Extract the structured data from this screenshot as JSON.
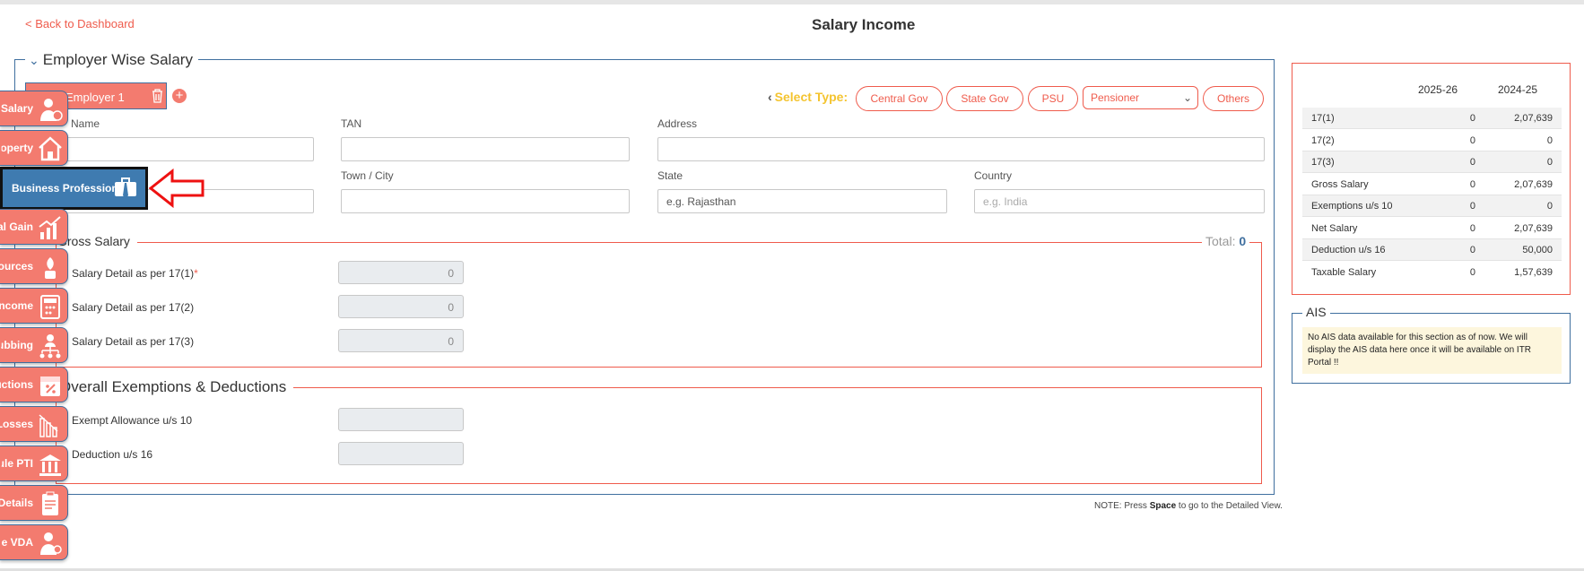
{
  "header": {
    "back_link": "< Back to Dashboard",
    "title": "Salary Income"
  },
  "employer": {
    "section_title": "Employer Wise Salary",
    "tab_label": "Employer 1",
    "select_type_label": "Select Type:",
    "types": [
      "Central Gov",
      "State Gov",
      "PSU"
    ],
    "pensioner_value": "Pensioner",
    "others_label": "Others",
    "fields": {
      "name_label": "Name",
      "tan_label": "TAN",
      "address_label": "Address",
      "town_label": "Town / City",
      "state_label": "State",
      "state_placeholder": "e.g. Rajasthan",
      "country_label": "Country",
      "country_placeholder": "e.g. India"
    }
  },
  "gross": {
    "title": "Gross Salary",
    "total_label": "Total:",
    "total_value": "0",
    "rows": [
      {
        "label": "Salary Detail as per 17(1)",
        "required": "*",
        "value": "0"
      },
      {
        "label": "Salary Detail as per 17(2)",
        "value": "0"
      },
      {
        "label": "Salary Detail as per 17(3)",
        "value": "0"
      }
    ]
  },
  "exemptions": {
    "title": "Overall Exemptions & Deductions",
    "rows": [
      {
        "label": "Exempt Allowance u/s 10",
        "value": ""
      },
      {
        "label": "Deduction u/s 16",
        "value": ""
      }
    ]
  },
  "note": {
    "prefix": "NOTE: Press ",
    "key": "Space",
    "suffix": " to go to the Detailed View."
  },
  "summary": {
    "col1": "2025-26",
    "col2": "2024-25",
    "rows": [
      {
        "key": "17(1)",
        "v1": "0",
        "v2": "2,07,639"
      },
      {
        "key": "17(2)",
        "v1": "0",
        "v2": "0"
      },
      {
        "key": "17(3)",
        "v1": "0",
        "v2": "0"
      },
      {
        "key": "Gross Salary",
        "v1": "0",
        "v2": "2,07,639"
      },
      {
        "key": "Exemptions u/s 10",
        "v1": "0",
        "v2": "0"
      },
      {
        "key": "Net Salary",
        "v1": "0",
        "v2": "2,07,639"
      },
      {
        "key": "Deduction u/s 16",
        "v1": "0",
        "v2": "50,000"
      },
      {
        "key": "Taxable Salary",
        "v1": "0",
        "v2": "1,57,639"
      }
    ]
  },
  "ais": {
    "title": "AIS",
    "message": "No AIS data available for this section as of now. We will display the AIS data here once it will be available on ITR Portal !!"
  },
  "sidebar": {
    "items": [
      {
        "label": "Salary",
        "icon": "person-money-icon"
      },
      {
        "label": "Property",
        "icon": "house-icon"
      },
      {
        "label": "Business Profession",
        "icon": "briefcase-tie-icon"
      },
      {
        "label": "Capital Gain",
        "icon": "growth-chart-icon"
      },
      {
        "label": "Other Sources",
        "icon": "plant-money-icon"
      },
      {
        "label": "Other Income",
        "icon": "tax-calculator-icon"
      },
      {
        "label": "Clubbing",
        "icon": "family-tree-icon"
      },
      {
        "label": "Deductions",
        "icon": "tax-percent-icon"
      },
      {
        "label": "Losses",
        "icon": "declining-chart-icon"
      },
      {
        "label": "Schedule PTI",
        "icon": "bank-icon"
      },
      {
        "label": "Tax Details",
        "icon": "tax-clipboard-icon"
      },
      {
        "label": "Schedule VDA",
        "icon": "person-coin-icon"
      }
    ]
  }
}
